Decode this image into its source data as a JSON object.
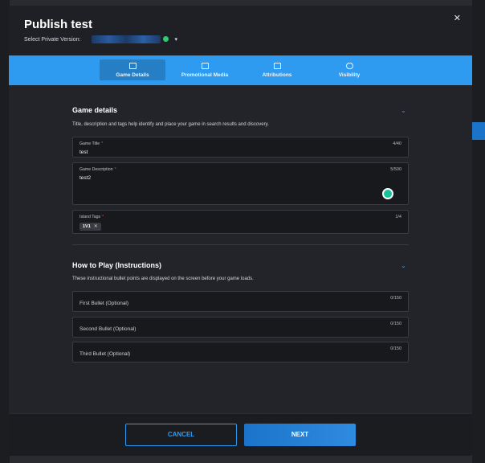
{
  "modal": {
    "title": "Publish test",
    "version_label": "Select Private Version:",
    "caret": "▾",
    "close": "✕"
  },
  "tabs": [
    {
      "label": "Game Details",
      "icon": "game-details-icon",
      "active": true
    },
    {
      "label": "Promotional Media",
      "icon": "image-icon",
      "active": false
    },
    {
      "label": "Attributions",
      "icon": "attributions-icon",
      "active": false
    },
    {
      "label": "Visibility",
      "icon": "eye-icon",
      "active": false
    }
  ],
  "game_details": {
    "title": "Game details",
    "description": "Title, description and tags help identify and place your game in search results and discovery.",
    "chevron": "⌄",
    "fields": {
      "game_title": {
        "label": "Game Title",
        "required": "*",
        "value": "test",
        "count": "4/40"
      },
      "game_description": {
        "label": "Game Description",
        "required": "*",
        "value": "test2",
        "count": "5/500"
      },
      "island_tags": {
        "label": "Island Tags",
        "required": "*",
        "count": "1/4",
        "tags": [
          "1V1"
        ],
        "tag_remove": "✕"
      }
    }
  },
  "how_to_play": {
    "title": "How to Play (Instructions)",
    "description": "These instructional bullet points are displayed on the screen before your game loads.",
    "chevron": "⌄",
    "bullets": [
      {
        "placeholder": "First Bullet (Optional)",
        "count": "0/150"
      },
      {
        "placeholder": "Second Bullet (Optional)",
        "count": "0/150"
      },
      {
        "placeholder": "Third Bullet (Optional)",
        "count": "0/150"
      }
    ]
  },
  "footer": {
    "cancel": "CANCEL",
    "next": "NEXT"
  },
  "colors": {
    "accent": "#2f9bf0",
    "primary_button": "#1b74c9",
    "required": "#e24b4b",
    "status_ok": "#2ecc71"
  }
}
